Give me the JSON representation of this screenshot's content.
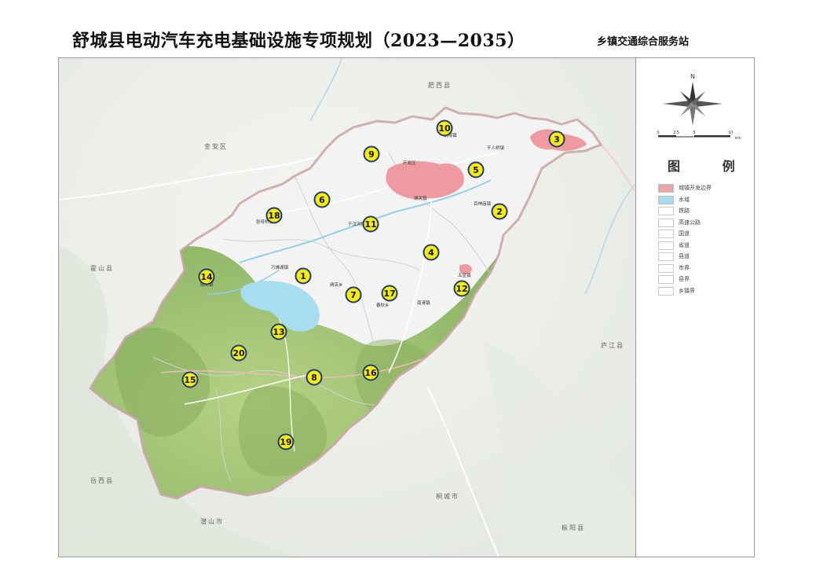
{
  "header": {
    "title": "舒城县电动汽车充电基础设施专项规划（2023—2035）",
    "subtitle": "乡镇交通综合服务站"
  },
  "map": {
    "neighbor_labels": [
      "肥西县",
      "金安区",
      "霍山县",
      "庐江县",
      "岳西县",
      "潜山市",
      "桐城市",
      "枞阳县"
    ],
    "town_labels": [
      "杭埠镇",
      "干人桥镇",
      "开发区",
      "城关镇",
      "百神庙镇",
      "张母桥镇",
      "干汊河镇",
      "万佛湖镇",
      "阙店乡",
      "春秋乡",
      "南港镇",
      "五显镇",
      "晓天镇"
    ],
    "markers": [
      "1",
      "2",
      "3",
      "4",
      "5",
      "6",
      "7",
      "8",
      "9",
      "10",
      "11",
      "12",
      "13",
      "14",
      "15",
      "16",
      "17",
      "18",
      "19",
      "20"
    ],
    "colors": {
      "marker_fill": "#f6ee0a",
      "marker_stroke": "#1f3a78",
      "county_fill": "#f3f3f3",
      "mountain": "#a9c97c",
      "urban": "#ef9aa0",
      "water": "#a6ddf0"
    }
  },
  "compass": {
    "north": "N",
    "scale_ticks": [
      "0",
      "2.5",
      "5",
      "10"
    ],
    "scale_unit": "km"
  },
  "legend": {
    "title": "图 例",
    "items": [
      {
        "label": "城镇开发边界",
        "color": "#eaa5aa"
      },
      {
        "label": "水域",
        "color": "#a6ddf0"
      },
      {
        "label": "铁路",
        "color": "#ffffff"
      },
      {
        "label": "高速公路",
        "color": "#ffffff"
      },
      {
        "label": "国道",
        "color": "#ffffff"
      },
      {
        "label": "省道",
        "color": "#ffffff"
      },
      {
        "label": "县道",
        "color": "#ffffff"
      },
      {
        "label": "市界",
        "color": "#ffffff"
      },
      {
        "label": "县界",
        "color": "#ffffff"
      },
      {
        "label": "乡镇界",
        "color": "#ffffff"
      }
    ]
  }
}
